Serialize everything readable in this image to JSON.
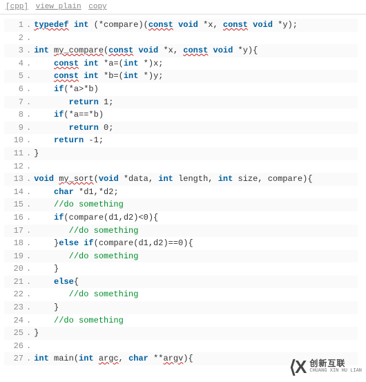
{
  "toolbar": {
    "lang": "[cpp]",
    "view_plain": "view plain",
    "copy": "copy"
  },
  "lines": [
    {
      "n": 1,
      "segs": [
        [
          "kw sq",
          "typedef"
        ],
        [
          "cc",
          " "
        ],
        [
          "ty",
          "int"
        ],
        [
          "cc",
          " (*compare)("
        ],
        [
          "kw sq",
          "const"
        ],
        [
          "cc",
          " "
        ],
        [
          "ty",
          "void"
        ],
        [
          "cc",
          " *x, "
        ],
        [
          "kw sq",
          "const"
        ],
        [
          "cc",
          " "
        ],
        [
          "ty",
          "void"
        ],
        [
          "cc",
          " *y);"
        ]
      ]
    },
    {
      "n": 2,
      "segs": []
    },
    {
      "n": 3,
      "segs": [
        [
          "ty",
          "int"
        ],
        [
          "cc",
          " "
        ],
        [
          "fn sq",
          "my_compare"
        ],
        [
          "cc",
          "("
        ],
        [
          "kw sq",
          "const"
        ],
        [
          "cc",
          " "
        ],
        [
          "ty",
          "void"
        ],
        [
          "cc",
          " *x, "
        ],
        [
          "kw sq",
          "const"
        ],
        [
          "cc",
          " "
        ],
        [
          "ty",
          "void"
        ],
        [
          "cc",
          " *y){"
        ]
      ]
    },
    {
      "n": 4,
      "segs": [
        [
          "cc",
          "    "
        ],
        [
          "kw sq",
          "const"
        ],
        [
          "cc",
          " "
        ],
        [
          "ty",
          "int"
        ],
        [
          "cc",
          " *a=("
        ],
        [
          "ty",
          "int"
        ],
        [
          "cc",
          " *)x;"
        ]
      ]
    },
    {
      "n": 5,
      "segs": [
        [
          "cc",
          "    "
        ],
        [
          "kw sq",
          "const"
        ],
        [
          "cc",
          " "
        ],
        [
          "ty",
          "int"
        ],
        [
          "cc",
          " *b=("
        ],
        [
          "ty",
          "int"
        ],
        [
          "cc",
          " *)y;"
        ]
      ]
    },
    {
      "n": 6,
      "segs": [
        [
          "cc",
          "    "
        ],
        [
          "kw",
          "if"
        ],
        [
          "cc",
          "(*a>*b)"
        ]
      ]
    },
    {
      "n": 7,
      "segs": [
        [
          "cc",
          "       "
        ],
        [
          "kw",
          "return"
        ],
        [
          "cc",
          " 1;"
        ]
      ]
    },
    {
      "n": 8,
      "segs": [
        [
          "cc",
          "    "
        ],
        [
          "kw",
          "if"
        ],
        [
          "cc",
          "(*a==*b)"
        ]
      ]
    },
    {
      "n": 9,
      "segs": [
        [
          "cc",
          "       "
        ],
        [
          "kw",
          "return"
        ],
        [
          "cc",
          " 0;"
        ]
      ]
    },
    {
      "n": 10,
      "segs": [
        [
          "cc",
          "    "
        ],
        [
          "kw",
          "return"
        ],
        [
          "cc",
          " -1;"
        ]
      ]
    },
    {
      "n": 11,
      "segs": [
        [
          "cc",
          "}"
        ]
      ]
    },
    {
      "n": 12,
      "segs": []
    },
    {
      "n": 13,
      "segs": [
        [
          "ty",
          "void"
        ],
        [
          "cc",
          " "
        ],
        [
          "fn sq",
          "my_sort"
        ],
        [
          "cc",
          "("
        ],
        [
          "ty",
          "void"
        ],
        [
          "cc",
          " *data, "
        ],
        [
          "ty",
          "int"
        ],
        [
          "cc",
          " length, "
        ],
        [
          "ty",
          "int"
        ],
        [
          "cc",
          " size, compare){"
        ]
      ]
    },
    {
      "n": 14,
      "segs": [
        [
          "cc",
          "    "
        ],
        [
          "ty",
          "char"
        ],
        [
          "cc",
          " *d1,*d2;"
        ]
      ]
    },
    {
      "n": 15,
      "segs": [
        [
          "cc",
          "    "
        ],
        [
          "com",
          "//do something"
        ]
      ]
    },
    {
      "n": 16,
      "segs": [
        [
          "cc",
          "    "
        ],
        [
          "kw",
          "if"
        ],
        [
          "cc",
          "(compare(d1,d2)<0){"
        ]
      ]
    },
    {
      "n": 17,
      "segs": [
        [
          "cc",
          "       "
        ],
        [
          "com",
          "//do something"
        ]
      ]
    },
    {
      "n": 18,
      "segs": [
        [
          "cc",
          "    }"
        ],
        [
          "kw",
          "else"
        ],
        [
          "cc",
          " "
        ],
        [
          "kw",
          "if"
        ],
        [
          "cc",
          "(compare(d1,d2)==0){"
        ]
      ]
    },
    {
      "n": 19,
      "segs": [
        [
          "cc",
          "       "
        ],
        [
          "com",
          "//do something"
        ]
      ]
    },
    {
      "n": 20,
      "segs": [
        [
          "cc",
          "    }"
        ]
      ]
    },
    {
      "n": 21,
      "segs": [
        [
          "cc",
          "    "
        ],
        [
          "kw",
          "else"
        ],
        [
          "cc",
          "{"
        ]
      ]
    },
    {
      "n": 22,
      "segs": [
        [
          "cc",
          "       "
        ],
        [
          "com",
          "//do something"
        ]
      ]
    },
    {
      "n": 23,
      "segs": [
        [
          "cc",
          "    }"
        ]
      ]
    },
    {
      "n": 24,
      "segs": [
        [
          "cc",
          "    "
        ],
        [
          "com",
          "//do something"
        ]
      ]
    },
    {
      "n": 25,
      "segs": [
        [
          "cc",
          "}"
        ]
      ]
    },
    {
      "n": 26,
      "segs": []
    },
    {
      "n": 27,
      "segs": [
        [
          "ty",
          "int"
        ],
        [
          "cc",
          " main("
        ],
        [
          "ty",
          "int"
        ],
        [
          "cc",
          " "
        ],
        [
          "cc sq",
          "argc"
        ],
        [
          "cc",
          ", "
        ],
        [
          "ty",
          "char"
        ],
        [
          "cc",
          " **"
        ],
        [
          "cc sq",
          "argv"
        ],
        [
          "cc",
          "){"
        ]
      ]
    }
  ],
  "watermark": {
    "glyph": "⟨X",
    "cn": "创新互联",
    "py": "CHUANG XIN HU LIAN"
  }
}
